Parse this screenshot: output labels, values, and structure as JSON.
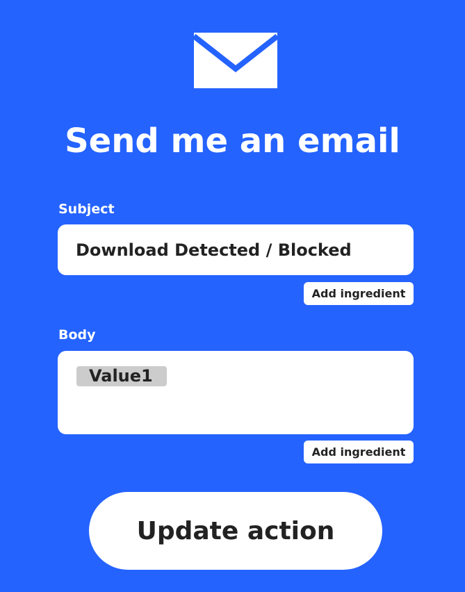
{
  "header": {
    "icon": "email-envelope-icon",
    "title": "Send me an email"
  },
  "form": {
    "subject": {
      "label": "Subject",
      "value": "Download Detected / Blocked",
      "add_ingredient_label": "Add ingredient"
    },
    "body": {
      "label": "Body",
      "ingredients": [
        "Value1"
      ],
      "add_ingredient_label": "Add ingredient"
    }
  },
  "actions": {
    "update_label": "Update action"
  },
  "colors": {
    "background": "#2563ff",
    "surface": "#ffffff",
    "text": "#222222",
    "ingredient_pill": "#cccccc"
  }
}
